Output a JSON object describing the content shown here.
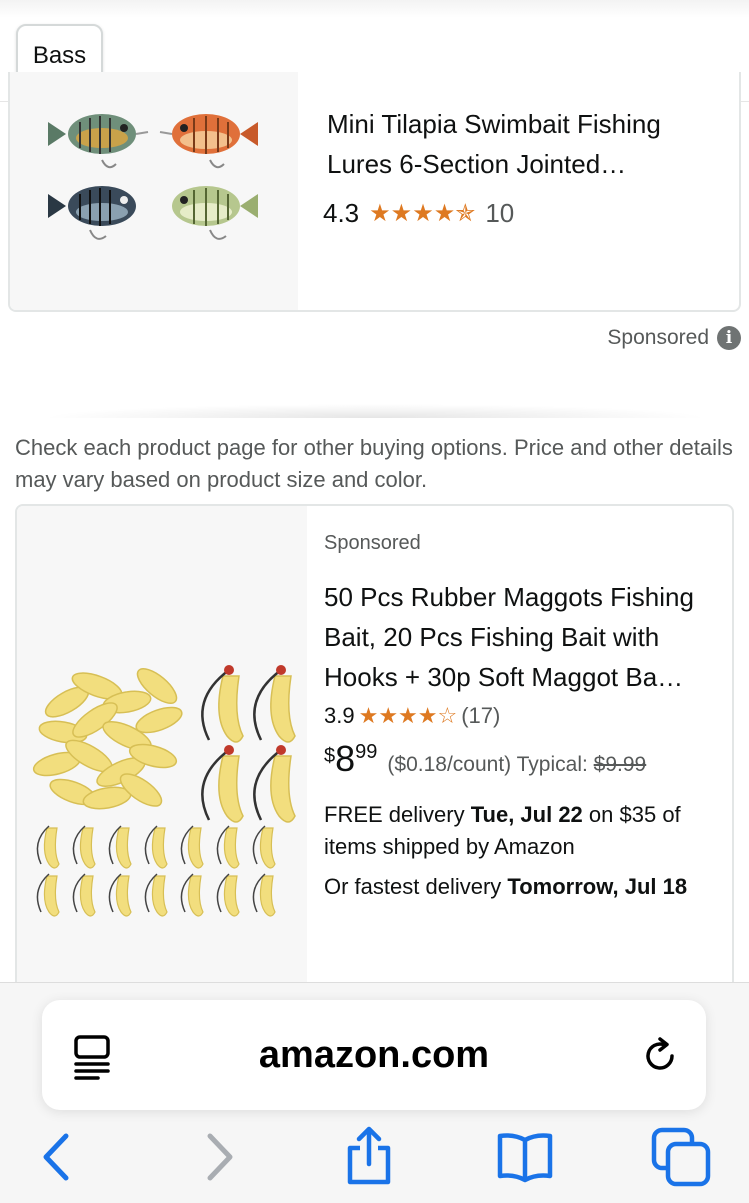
{
  "filter_chip": {
    "label": "Bass"
  },
  "product1": {
    "title": "Mini Tilapia Swimbait Fishing Lures 6-Section Jointed…",
    "rating": "4.3",
    "stars": "★★★★✯",
    "review_count": "10",
    "image_desc": "fishing-lures-image"
  },
  "sponsored_info": {
    "label": "Sponsored",
    "icon": "info-icon"
  },
  "disclaimer": "Check each product page for other buying options. Price and other details may vary based on product size and color.",
  "product2": {
    "sponsored": "Sponsored",
    "title": "50 Pcs Rubber Maggots Fishing Bait, 20 Pcs Fishing Bait with Hooks + 30p Soft Maggot Ba…",
    "rating": "3.9",
    "stars": "★★★★☆",
    "review_count": "(17)",
    "price_symbol": "$",
    "price_whole": "8",
    "price_fraction": "99",
    "unit_price": "($0.18/count)",
    "typical_label": "Typical:",
    "typical_price": "$9.99",
    "delivery_prefix": "FREE delivery",
    "delivery_date": "Tue, Jul 22",
    "delivery_suffix": "on $35 of items shipped by Amazon",
    "fastest_prefix": "Or fastest delivery",
    "fastest_date": "Tomorrow, Jul 18"
  },
  "browser": {
    "url": "amazon.com",
    "accent_color": "#1a73e8",
    "icons": [
      "reader-icon",
      "reload-icon",
      "back-icon",
      "forward-icon",
      "share-icon",
      "bookmarks-icon",
      "tabs-icon"
    ]
  }
}
